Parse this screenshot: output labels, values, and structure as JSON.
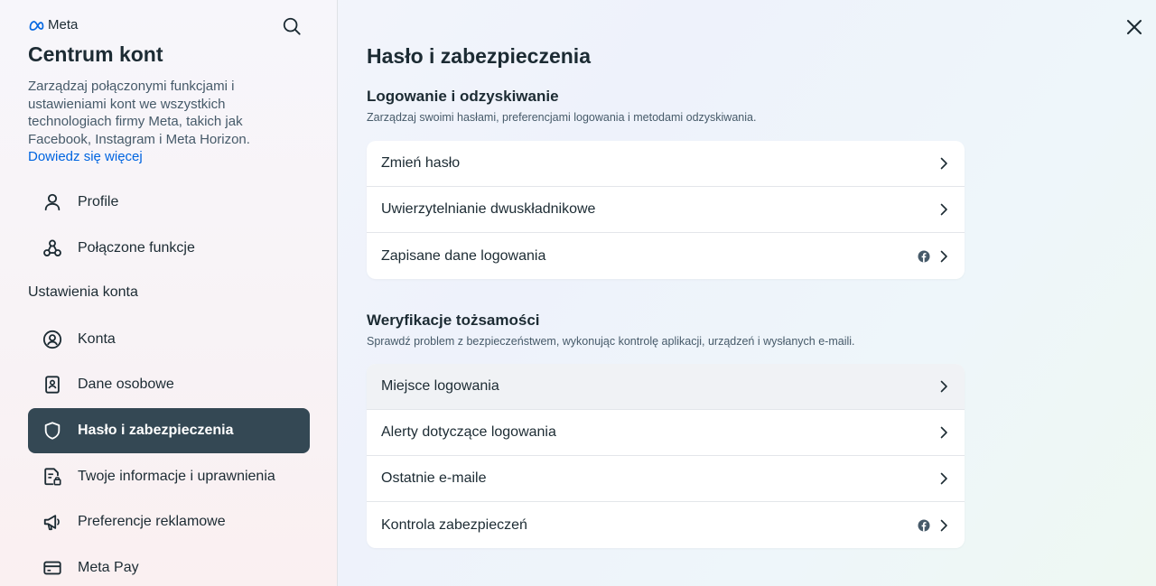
{
  "sidebar": {
    "brand": "Meta",
    "title": "Centrum kont",
    "description": "Zarządzaj połączonymi funkcjami i ustawieniami kont we wszystkich technologiach firmy Meta, takich jak Facebook, Instagram i Meta Horizon.",
    "learn_more": "Dowiedz się więcej",
    "top_items": [
      {
        "label": "Profile",
        "icon": "person-icon"
      },
      {
        "label": "Połączone funkcje",
        "icon": "connected-nodes-icon"
      }
    ],
    "section_label": "Ustawienia konta",
    "items": [
      {
        "label": "Konta",
        "icon": "account-circle-icon"
      },
      {
        "label": "Dane osobowe",
        "icon": "id-card-icon"
      },
      {
        "label": "Hasło i zabezpieczenia",
        "icon": "shield-icon",
        "active": true
      },
      {
        "label": "Twoje informacje i uprawnienia",
        "icon": "document-lock-icon"
      },
      {
        "label": "Preferencje reklamowe",
        "icon": "megaphone-icon"
      },
      {
        "label": "Meta Pay",
        "icon": "credit-card-icon"
      }
    ]
  },
  "main": {
    "title": "Hasło i zabezpieczenia",
    "login_section": {
      "title": "Logowanie i odzyskiwanie",
      "description": "Zarządzaj swoimi hasłami, preferencjami logowania i metodami odzyskiwania.",
      "rows": [
        {
          "label": "Zmień hasło",
          "facebook_icon": false
        },
        {
          "label": "Uwierzytelnianie dwuskładnikowe",
          "facebook_icon": false
        },
        {
          "label": "Zapisane dane logowania",
          "facebook_icon": true
        }
      ]
    },
    "verification_section": {
      "title": "Weryfikacje tożsamości",
      "description": "Sprawdź problem z bezpieczeństwem, wykonując kontrolę aplikacji, urządzeń i wysłanych e-maili.",
      "rows": [
        {
          "label": "Miejsce logowania",
          "facebook_icon": false,
          "hovered": true
        },
        {
          "label": "Alerty dotyczące logowania",
          "facebook_icon": false
        },
        {
          "label": "Ostatnie e-maile",
          "facebook_icon": false
        },
        {
          "label": "Kontrola zabezpieczeń",
          "facebook_icon": true
        }
      ]
    }
  },
  "colors": {
    "accent_link": "#0064e0",
    "active_nav_bg": "#344854",
    "text_primary": "#1c2b33",
    "text_secondary": "#465a69"
  }
}
